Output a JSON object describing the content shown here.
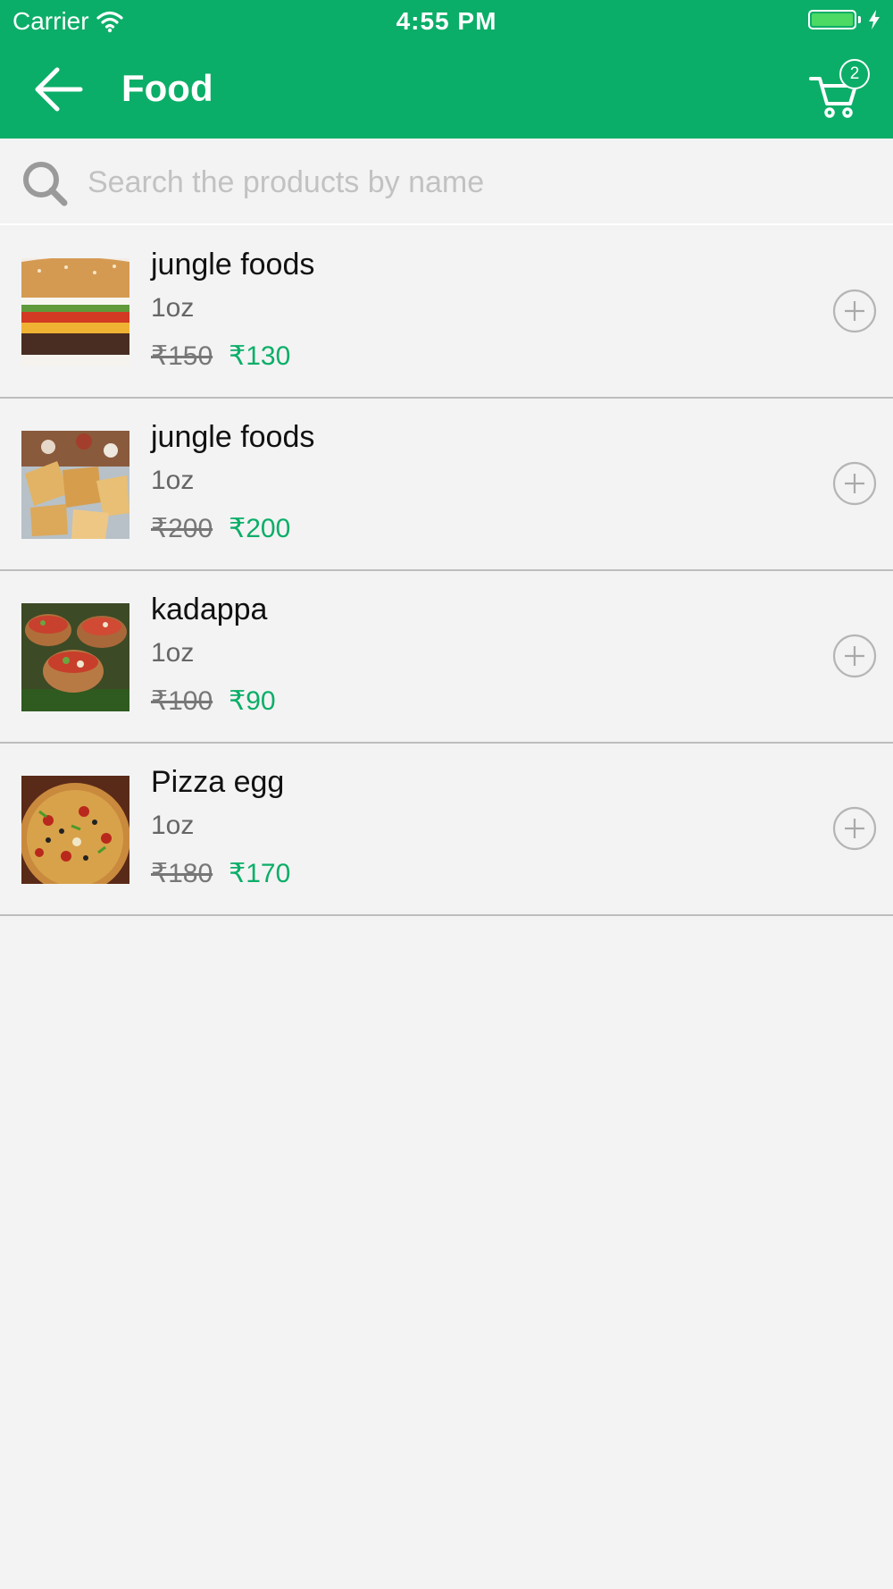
{
  "status_bar": {
    "carrier": "Carrier",
    "time": "4:55 PM"
  },
  "header": {
    "title": "Food",
    "cart_count": "2",
    "back_icon": "arrow-left-icon",
    "cart_icon": "cart-icon"
  },
  "search": {
    "placeholder": "Search the products by name",
    "icon": "search-icon"
  },
  "colors": {
    "brand": "#0bae68",
    "background": "#f3f3f3",
    "price_new": "#0bae68",
    "price_old": "#777777"
  },
  "products": [
    {
      "name": "jungle foods",
      "unit": "1oz",
      "old_price": "₹150",
      "new_price": "₹130",
      "image": "burger"
    },
    {
      "name": "jungle foods",
      "unit": "1oz",
      "old_price": "₹200",
      "new_price": "₹200",
      "image": "chips"
    },
    {
      "name": "kadappa",
      "unit": "1oz",
      "old_price": "₹100",
      "new_price": "₹90",
      "image": "baskets"
    },
    {
      "name": "Pizza egg",
      "unit": "1oz",
      "old_price": "₹180",
      "new_price": "₹170",
      "image": "pizza"
    }
  ]
}
